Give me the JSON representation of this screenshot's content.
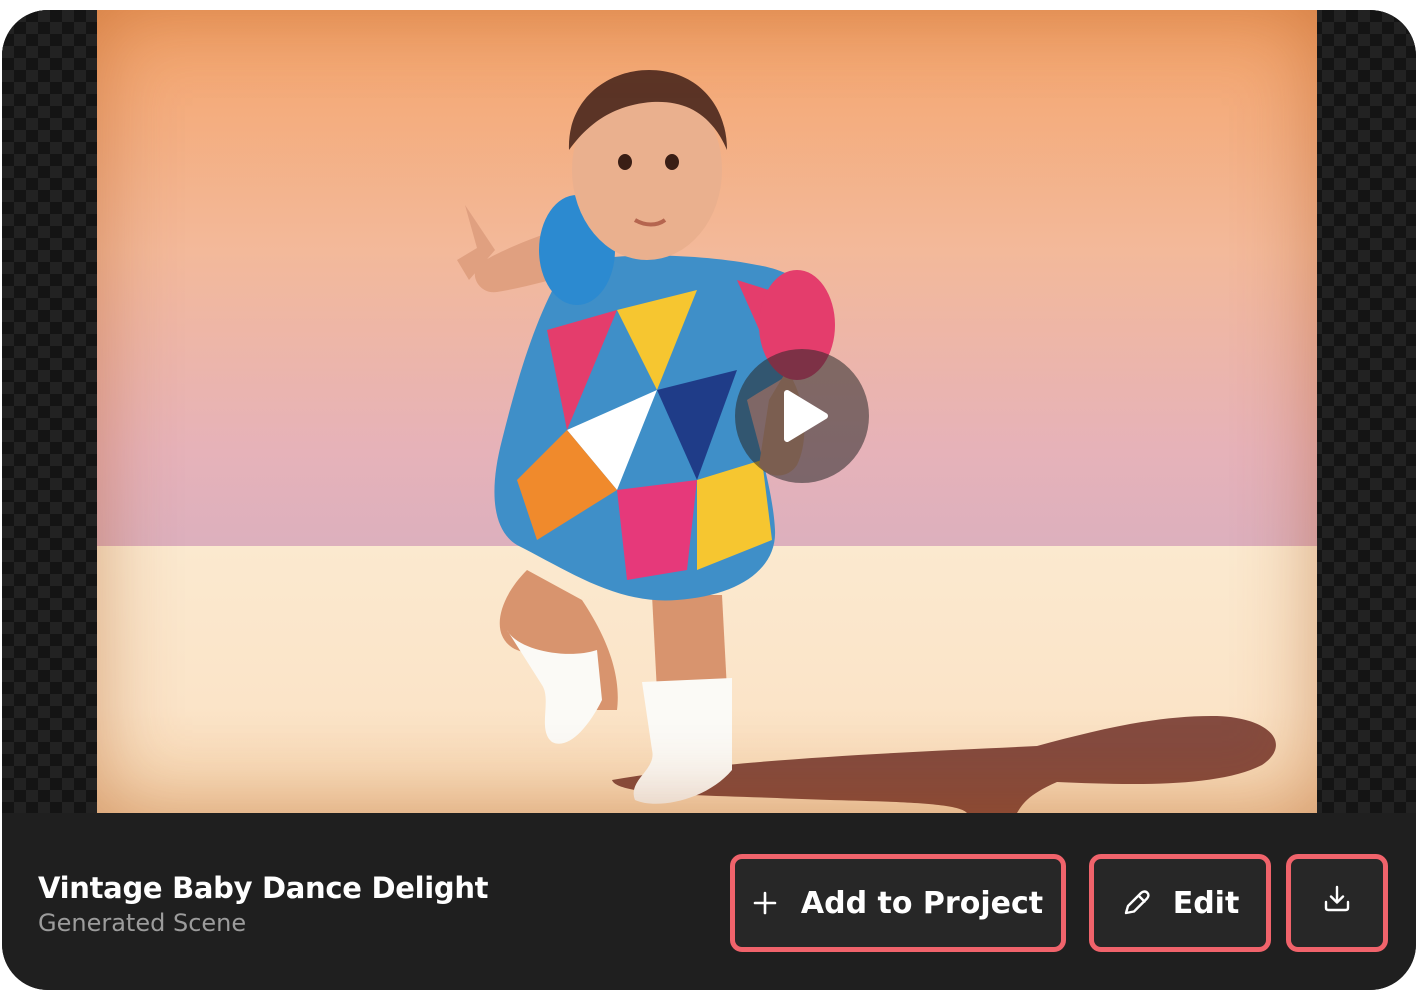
{
  "media": {
    "play_label": "Play video",
    "colors": {
      "backdrop_top": "#f4a46a",
      "backdrop_bottom": "#ddb0bd",
      "floor": "#fbe9cf"
    }
  },
  "info": {
    "title": "Vintage Baby Dance Delight",
    "subtitle": "Generated Scene"
  },
  "actions": {
    "add_to_project": {
      "label": "Add to Project",
      "icon": "plus-icon"
    },
    "edit": {
      "label": "Edit",
      "icon": "pencil-icon"
    },
    "download": {
      "icon": "download-icon"
    }
  },
  "colors": {
    "highlight_border": "#f0636b",
    "bar_background": "#1f1f1f",
    "button_background": "#272727"
  }
}
